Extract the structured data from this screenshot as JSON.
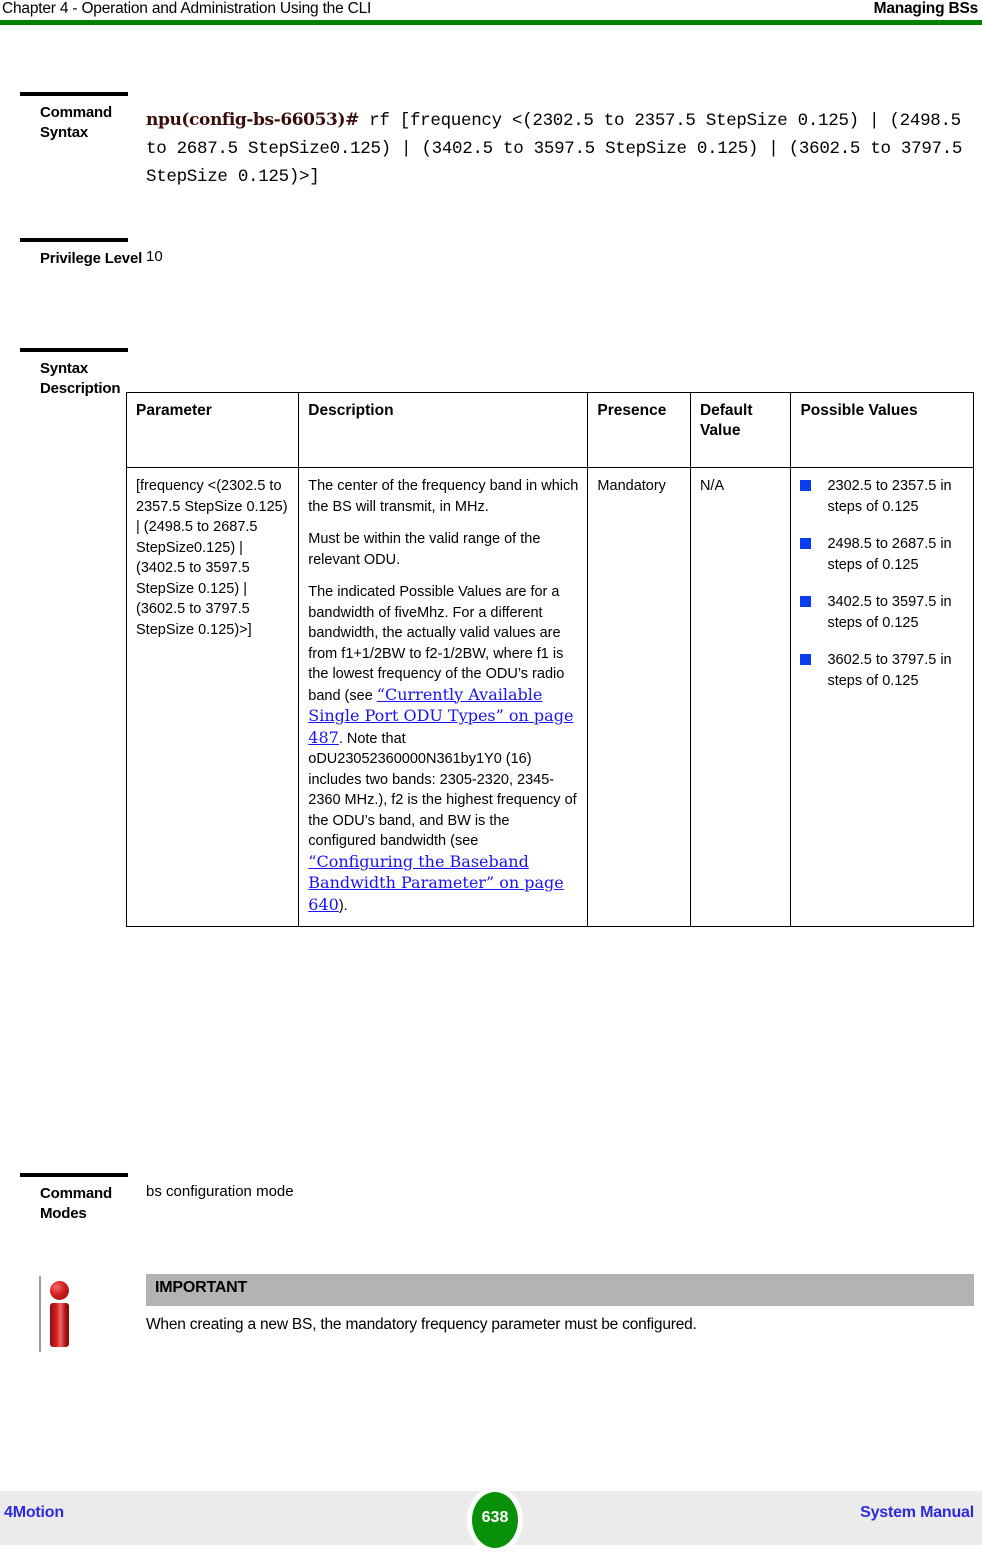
{
  "header": {
    "left": "Chapter 4 - Operation and Administration Using the CLI",
    "right": "Managing BSs",
    "rule_color": "#008000"
  },
  "command_syntax": {
    "label": "Command Syntax",
    "prompt": "npu(config-bs-66053)#",
    "prompt_color": "#3a0d0d",
    "command": " rf [frequency <(2302.5 to 2357.5 StepSize 0.125) | (2498.5 to 2687.5 StepSize0.125) | (3402.5 to 3597.5 StepSize 0.125) | (3602.5 to 3797.5 StepSize 0.125)>]"
  },
  "privilege_level": {
    "label": "Privilege Level",
    "value": "10"
  },
  "syntax_description": {
    "label": "Syntax Description",
    "columns": [
      "Parameter",
      "Description",
      "Presence",
      "Default Value",
      "Possible Values"
    ],
    "row": {
      "parameter": "[frequency <(2302.5 to 2357.5 StepSize 0.125) | (2498.5 to 2687.5 StepSize0.125) | (3402.5 to 3597.5 StepSize 0.125) | (3602.5 to 3797.5 StepSize 0.125)>]",
      "description": {
        "p1": "The center of the frequency band in which the BS will transmit, in MHz.",
        "p2": "Must be within the valid range of the relevant ODU.",
        "p3_a": "The indicated Possible Values are for a bandwidth of fiveMhz. For a different bandwidth, the actually valid values are from f1+1/2BW to f2-1/2BW, where f1 is the lowest frequency of the ODU’s radio band (see ",
        "p3_link1": "“Currently Available Single Port ODU Types” on page 487",
        "p3_b": ". Note that oDU23052360000N361by1Y0 (16) includes two bands: 2305-2320, 2345-2360 MHz.), f2 is the highest frequency of the ODU’s band, and BW is the configured bandwidth (see ",
        "p3_link2": "“Configuring the Baseband Bandwidth Parameter” on page 640",
        "p3_c": ")."
      },
      "presence": "Mandatory",
      "default_value": "N/A",
      "possible_values": [
        "2302.5 to 2357.5 in steps of 0.125",
        "2498.5 to 2687.5 in steps of 0.125",
        "3402.5 to 3597.5 in steps of 0.125",
        "3602.5 to 3797.5  in steps of 0.125"
      ],
      "bullet_color": "#0a3df0"
    },
    "link_color": "#1a12ef"
  },
  "command_modes": {
    "label": "Command Modes",
    "value": "bs configuration mode"
  },
  "important_note": {
    "icon": "info-icon",
    "heading": "IMPORTANT",
    "body": "When creating a new BS, the mandatory frequency parameter must be configured.",
    "header_bg": "#b3b3b3"
  },
  "footer": {
    "left": "4Motion",
    "page_number": "638",
    "right": "System Manual",
    "link_color": "#2b2bdd",
    "page_circle_color": "#089008"
  }
}
